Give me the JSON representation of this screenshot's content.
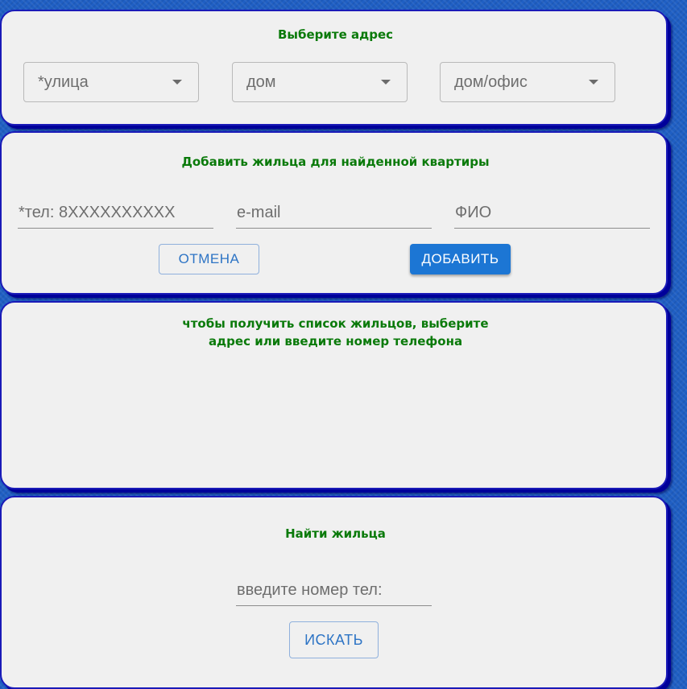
{
  "address_panel": {
    "title": "Выберите адрес",
    "street_select": "*улица",
    "house_select": "дом",
    "apartment_select": "дом/офис"
  },
  "add_resident_panel": {
    "title": "Добавить жильца для найденной квартиры",
    "phone_placeholder": "*тел: 8XXXXXXXXXX",
    "email_placeholder": "e-mail",
    "name_placeholder": "ФИО",
    "cancel_label": "ОТМЕНА",
    "add_label": "ДОБАВИТЬ"
  },
  "residents_panel": {
    "message_line1": "чтобы получить список жильцов, выберите",
    "message_line2": "адрес или введите номер телефона"
  },
  "find_resident_panel": {
    "title": "Найти жильца",
    "phone_placeholder": "введите номер тел:",
    "search_label": "ИСКАТЬ"
  },
  "colors": {
    "title_green": "#0a7a0a",
    "panel_border": "#1a1ab8",
    "primary_button": "#1c76d4",
    "background_blue": "#1f5fc4"
  },
  "icons": {
    "dropdown": "caret-down-icon"
  }
}
